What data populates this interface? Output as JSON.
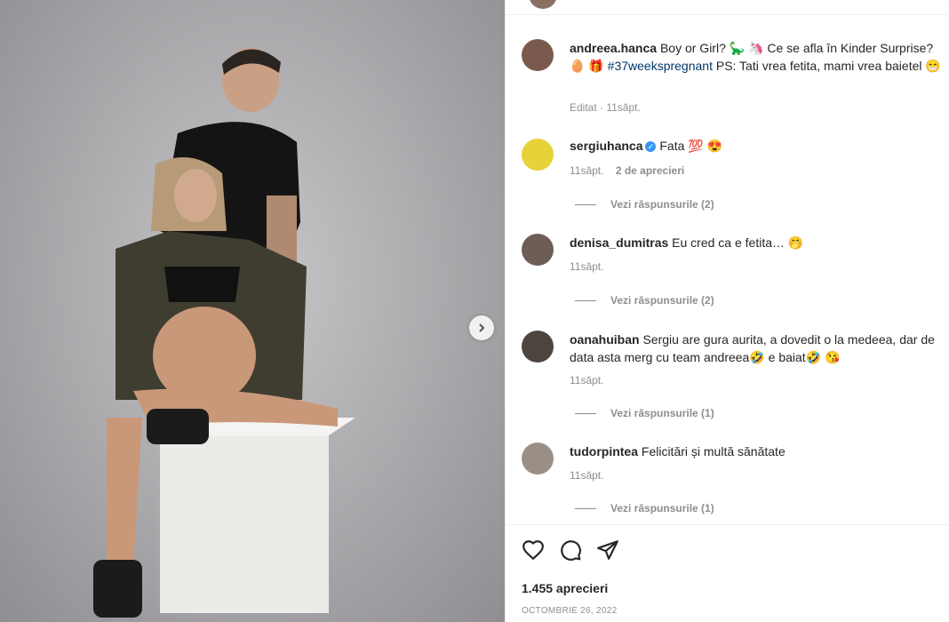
{
  "post": {
    "author": "andreea.hanca",
    "caption_a": "Boy or Girl? 🦕 🦄 Ce se afla în Kinder Surprise?",
    "caption_b_emoji": "🥚 🎁",
    "hashtag": "#37weekspregnant",
    "caption_c": "PS: Tati vrea fetita, mami vrea baietel",
    "caption_end": "😁",
    "meta": "Editat · 11săpt."
  },
  "comments": [
    {
      "user": "sergiuhanca",
      "verified": true,
      "text": "Fata 💯 😍",
      "time": "11săpt.",
      "likes": "2 de aprecieri",
      "replies": "Vezi răspunsurile (2)"
    },
    {
      "user": "denisa_dumitras",
      "verified": false,
      "text": "Eu cred ca e fetita… 🤭",
      "time": "11săpt.",
      "likes": "",
      "replies": "Vezi răspunsurile (2)"
    },
    {
      "user": "oanahuiban",
      "verified": false,
      "text": "Sergiu are gura aurita, a dovedit o la medeea, dar de data asta merg cu team andreea🤣 e baiat🤣 😘",
      "time": "11săpt.",
      "likes": "",
      "replies": "Vezi răspunsurile (1)"
    },
    {
      "user": "tudorpintea",
      "verified": false,
      "text": "Felicitări și multă sănătate",
      "time": "11săpt.",
      "likes": "",
      "replies": "Vezi răspunsurile (1)"
    }
  ],
  "footer": {
    "likes": "1.455 aprecieri",
    "date": "OCTOMBRIE 26, 2022"
  },
  "icons": {
    "like": "heart-icon",
    "comment": "comment-icon",
    "share": "share-icon",
    "next": "chevron-right-icon"
  }
}
